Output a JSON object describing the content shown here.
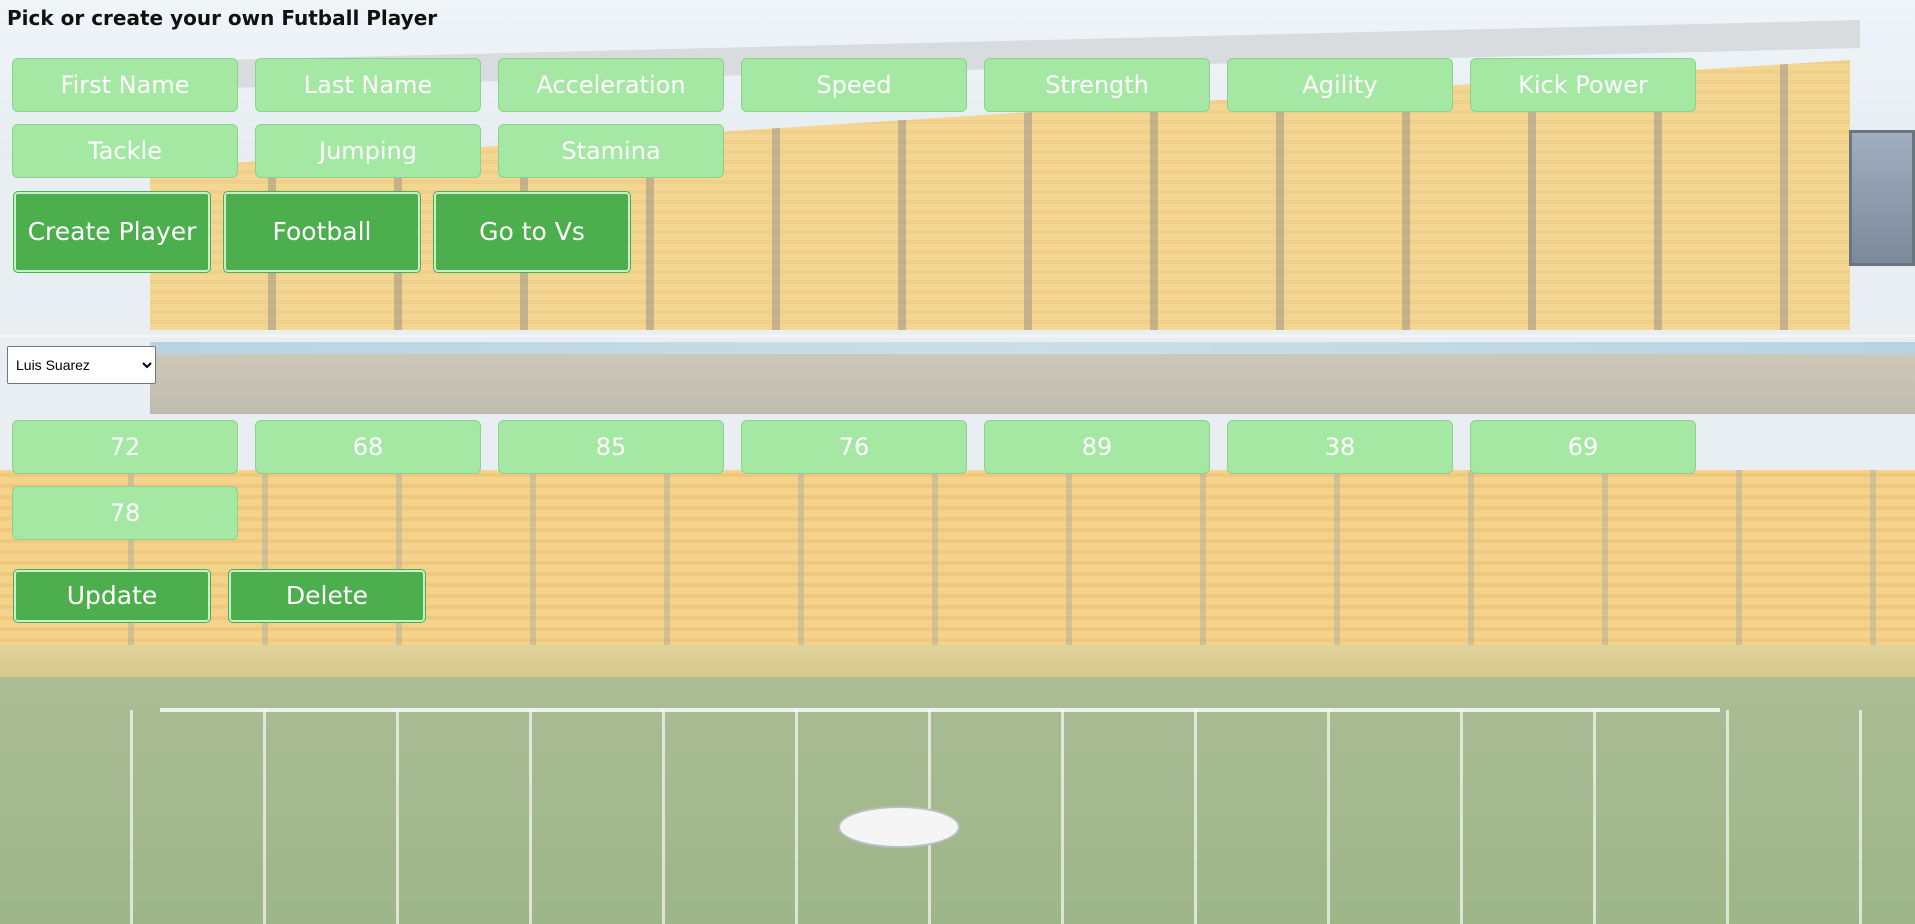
{
  "page": {
    "title": "Pick or create your own Futball Player"
  },
  "stat_fields": [
    "First Name",
    "Last Name",
    "Acceleration",
    "Speed",
    "Strength",
    "Agility",
    "Kick Power",
    "Tackle",
    "Jumping",
    "Stamina"
  ],
  "create_actions": {
    "create_player": "Create Player",
    "football": "Football",
    "go_to_vs": "Go to Vs"
  },
  "player_select": {
    "selected": "Luis Suarez",
    "options": [
      "Luis Suarez"
    ]
  },
  "player_stats": [
    "72",
    "68",
    "85",
    "76",
    "89",
    "38",
    "69",
    "78"
  ],
  "edit_actions": {
    "update": "Update",
    "delete": "Delete"
  },
  "colors": {
    "field_button": "#a4e8a3",
    "action_button": "#4cae4c",
    "button_text": "#ffffff"
  }
}
